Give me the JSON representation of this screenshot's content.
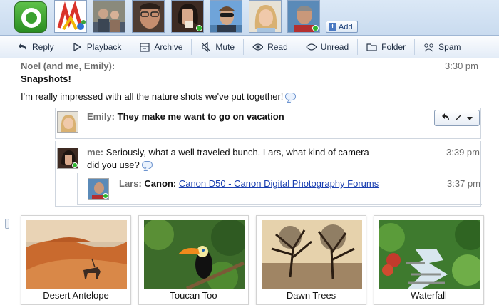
{
  "participants": {
    "add_label": "Add",
    "people": [
      {
        "name": "wave-logo"
      },
      {
        "name": "gadget-icon"
      },
      {
        "name": "family-photo"
      },
      {
        "name": "man-glasses"
      },
      {
        "name": "woman-1",
        "online": true
      },
      {
        "name": "man-sunglasses"
      },
      {
        "name": "woman-blonde"
      },
      {
        "name": "lars",
        "online": true
      }
    ]
  },
  "toolbar": {
    "reply": "Reply",
    "playback": "Playback",
    "archive": "Archive",
    "mute": "Mute",
    "read": "Read",
    "unread": "Unread",
    "folder": "Folder",
    "spam": "Spam"
  },
  "wave": {
    "header": "Noel (and me, Emily):",
    "header_time": "3:30 pm",
    "title": "Snapshots!",
    "body": "I'm really impressed with all the nature shots we've put together!"
  },
  "replies": [
    {
      "author": "Emily:",
      "text": "They make me want to go on vacation",
      "time": ""
    },
    {
      "author": "me:",
      "text": "Seriously, what a well traveled bunch. Lars, what kind of camera",
      "text2": "did you use?",
      "time": "3:39 pm"
    },
    {
      "author": "Lars:",
      "text": "Canon:",
      "link": "Canon D50 - Canon Digital Photography Forums",
      "time": "3:37 pm"
    }
  ],
  "thumbnails": [
    {
      "caption": "Desert Antelope"
    },
    {
      "caption": "Toucan Too"
    },
    {
      "caption": "Dawn Trees"
    },
    {
      "caption": "Waterfall"
    }
  ],
  "colors": {
    "accent": "#2fb52f",
    "link": "#1a3fb0",
    "toolbar": "#e3ecf7"
  }
}
